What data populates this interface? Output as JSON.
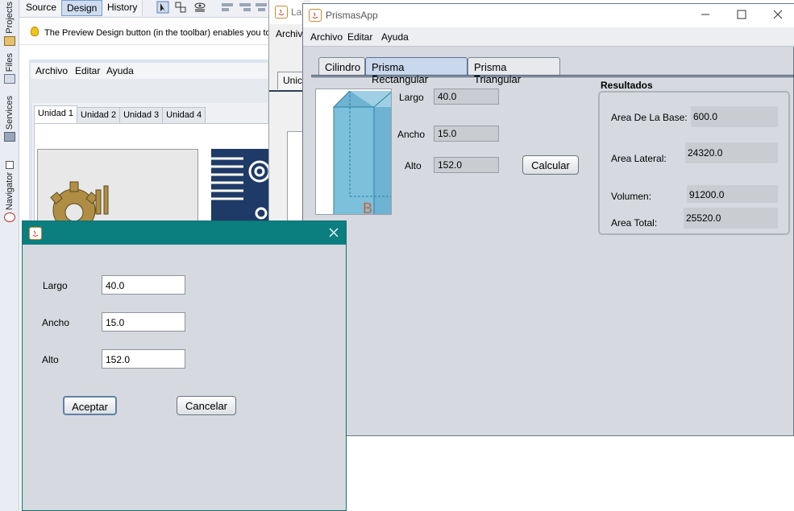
{
  "ide": {
    "tabs": [
      "Source",
      "Design",
      "History"
    ],
    "side_tabs": [
      "Projects",
      "Files",
      "Services",
      "Navigator"
    ],
    "hint": "The Preview Design button (in the toolbar) enables you to",
    "design_menu": [
      "Archivo",
      "Editar",
      "Ayuda"
    ],
    "design_tabs": [
      "Unidad 1",
      "Unidad 2",
      "Unidad 3",
      "Unidad 4"
    ]
  },
  "mid_window": {
    "title": "La",
    "menu": "Archiv",
    "tab": "Unic"
  },
  "app": {
    "title": "PrismasApp",
    "menu": [
      "Archivo",
      "Editar",
      "Ayuda"
    ],
    "tabs": [
      "Cilindro",
      "Prisma Rectangular",
      "Prisma Triangular"
    ],
    "active_tab": "Prisma Rectangular",
    "inputs": {
      "largo_label": "Largo",
      "largo_value": "40.0",
      "ancho_label": "Ancho",
      "ancho_value": "15.0",
      "alto_label": "Alto",
      "alto_value": "152.0"
    },
    "calcular_label": "Calcular",
    "prism_letter": "B",
    "results": {
      "title": "Resultados",
      "base_label": "Area De La Base:",
      "base_value": "600.0",
      "lateral_label": "Area Lateral:",
      "lateral_value": "24320.0",
      "volumen_label": "Volumen:",
      "volumen_value": "91200.0",
      "total_label": "Area Total:",
      "total_value": "25520.0"
    }
  },
  "dialog": {
    "largo_label": "Largo",
    "largo_value": "40.0",
    "ancho_label": "Ancho",
    "ancho_value": "15.0",
    "alto_label": "Alto",
    "alto_value": "152.0",
    "accept_label": "Aceptar",
    "cancel_label": "Cancelar"
  },
  "colors": {
    "dialog_titlebar": "#0b7f80",
    "app_background": "#d6d9df",
    "active_tab": "#c9d8ec"
  }
}
